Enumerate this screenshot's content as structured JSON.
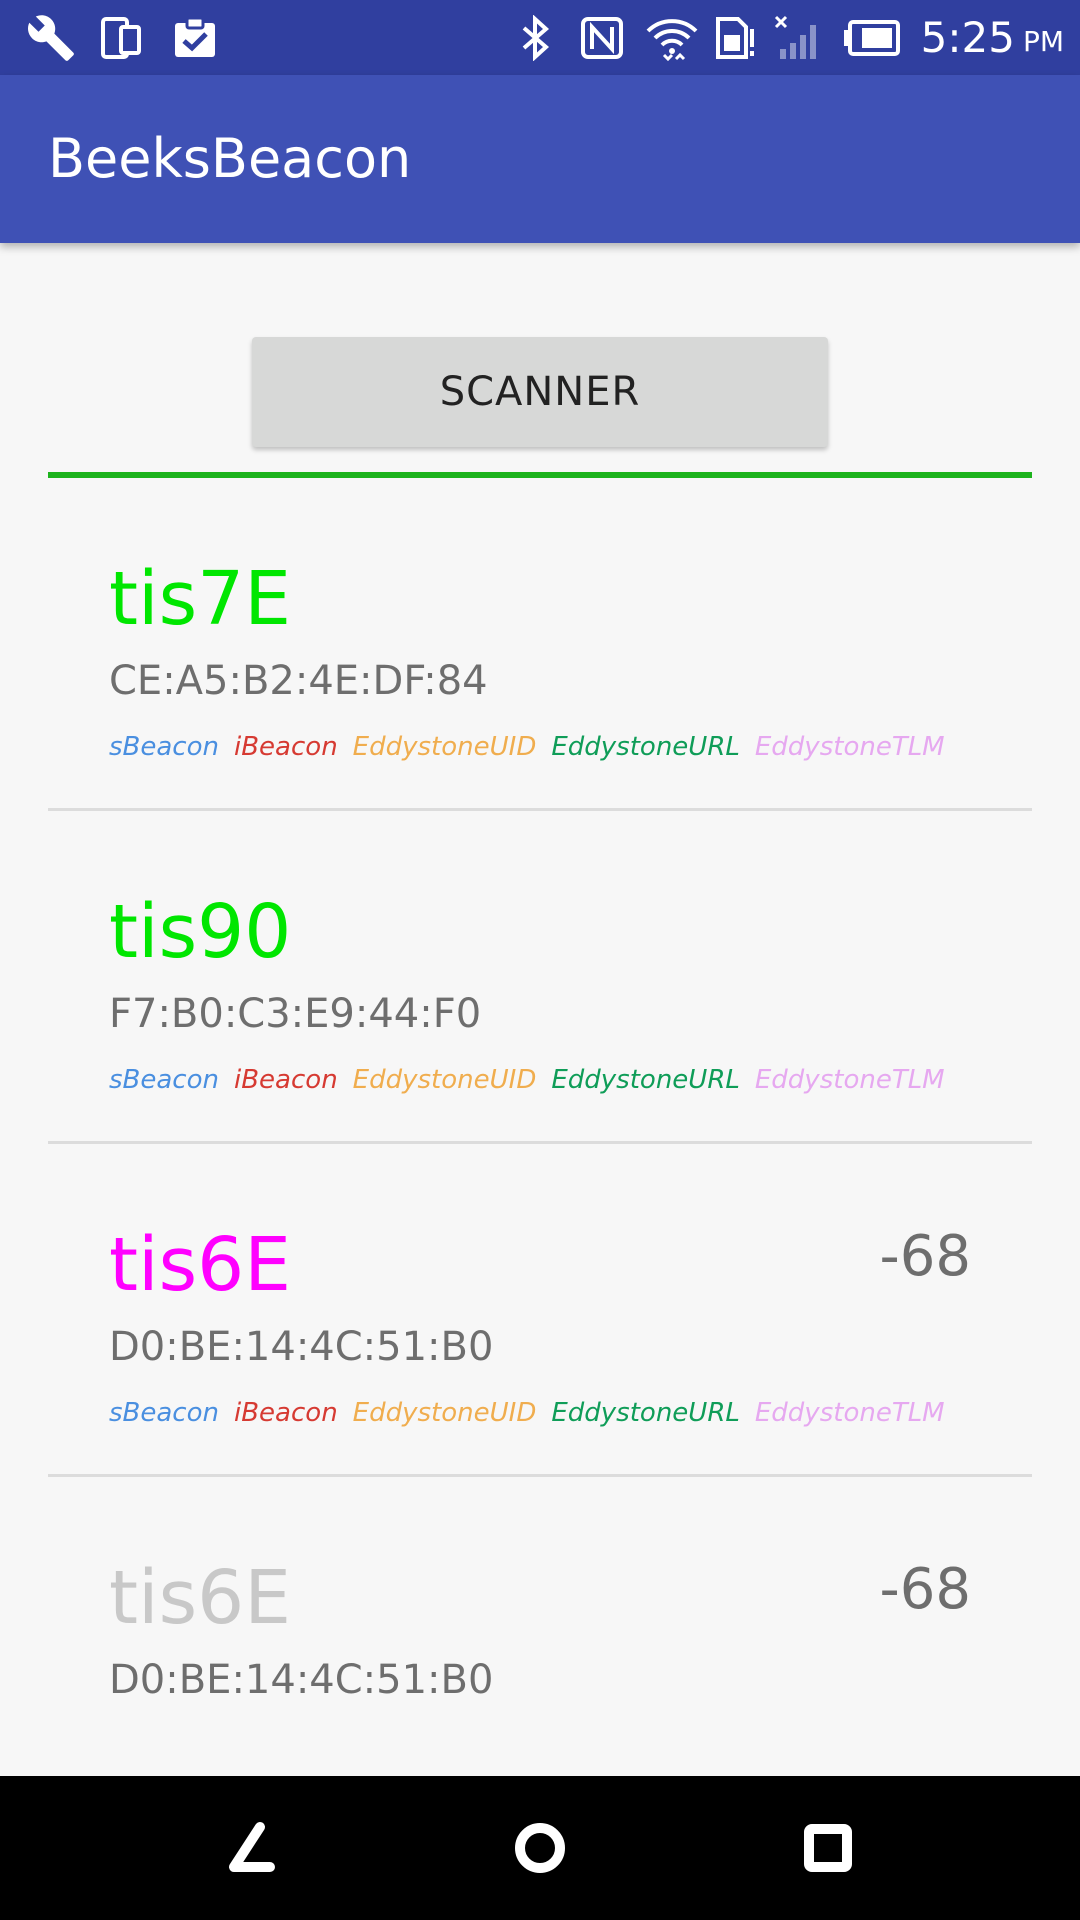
{
  "status_bar": {
    "time": "5:25",
    "ampm": "PM",
    "left_icons": [
      "wrench-icon",
      "device-icon",
      "clipboard-check-icon"
    ],
    "right_icons": [
      "bluetooth-icon",
      "nfc-icon",
      "wifi-icon",
      "sim-alert-icon",
      "signal-off-icon",
      "battery-icon"
    ]
  },
  "app_bar": {
    "title": "BeeksBeacon"
  },
  "scanner": {
    "label": "SCANNER",
    "progress": 1.0,
    "progress_color": "#1db31d"
  },
  "tag_colors": {
    "sBeacon": "#4a8fe0",
    "iBeacon": "#d63a32",
    "EddystoneUID": "#f0ad4e",
    "EddystoneURL": "#0f9d58",
    "EddystoneTLM": "#e6a8f0"
  },
  "beacons": [
    {
      "name": "tis7E",
      "name_color": "#00e600",
      "mac": "CE:A5:B2:4E:DF:84",
      "rssi": "",
      "tags": [
        "sBeacon",
        "iBeacon",
        "EddystoneUID",
        "EddystoneURL",
        "EddystoneTLM"
      ]
    },
    {
      "name": "tis90",
      "name_color": "#00e600",
      "mac": "F7:B0:C3:E9:44:F0",
      "rssi": "",
      "tags": [
        "sBeacon",
        "iBeacon",
        "EddystoneUID",
        "EddystoneURL",
        "EddystoneTLM"
      ]
    },
    {
      "name": "tis6E",
      "name_color": "#ff00ff",
      "mac": "D0:BE:14:4C:51:B0",
      "rssi": "-68",
      "tags": [
        "sBeacon",
        "iBeacon",
        "EddystoneUID",
        "EddystoneURL",
        "EddystoneTLM"
      ]
    },
    {
      "name": "tis6E",
      "name_color": "#c8c8c8",
      "mac": "D0:BE:14:4C:51:B0",
      "rssi": "-68",
      "tags": []
    }
  ],
  "nav_bar": {
    "buttons": [
      "back-icon",
      "home-icon",
      "recents-icon"
    ]
  }
}
